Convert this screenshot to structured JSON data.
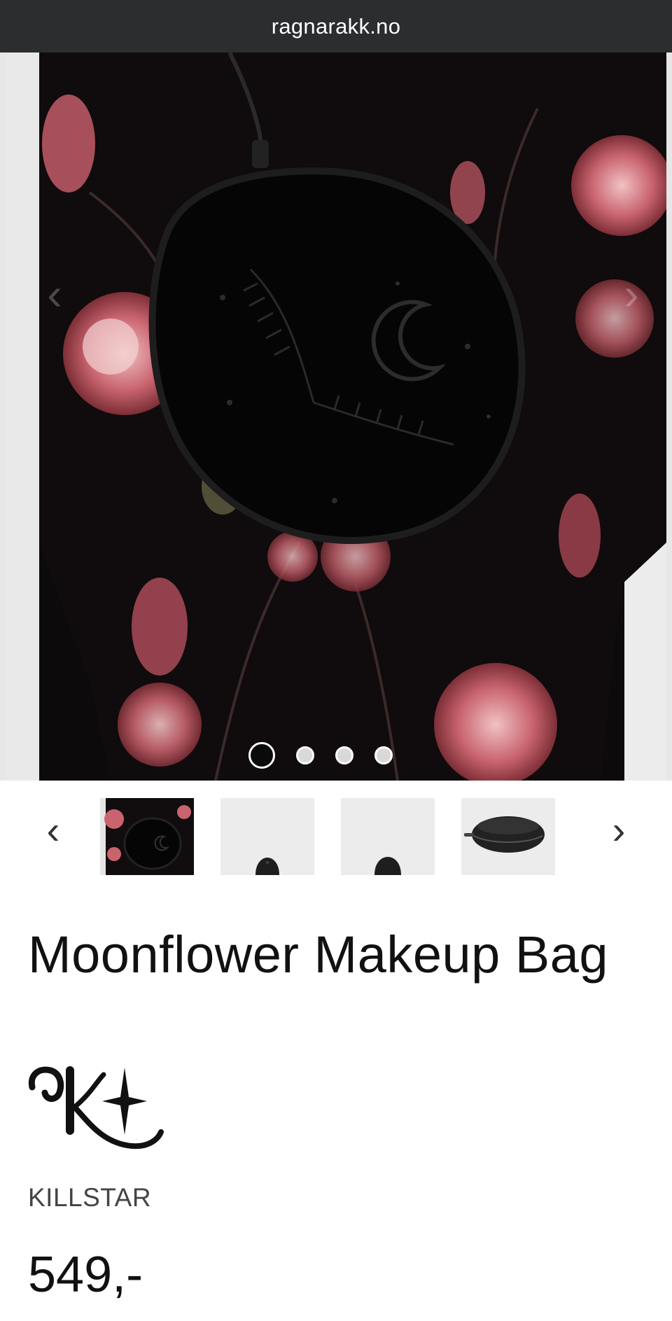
{
  "browser": {
    "url": "ragnarakk.no"
  },
  "gallery": {
    "arrows": {
      "prev_icon": "chevron-left-icon",
      "next_icon": "chevron-right-icon"
    },
    "dots_total": 4,
    "active_dot": 1,
    "thumbnail_count": 4
  },
  "thumbnails": {
    "prev_label": "‹",
    "next_label": "›"
  },
  "product": {
    "title": "Moonflower Makeup Bag",
    "brand": "KILLSTAR",
    "price": "549,-"
  },
  "colors": {
    "url_bar": "#2b2d2f",
    "fabric": "#0d0a0b",
    "flower": "#c9646f",
    "text": "#111111"
  }
}
